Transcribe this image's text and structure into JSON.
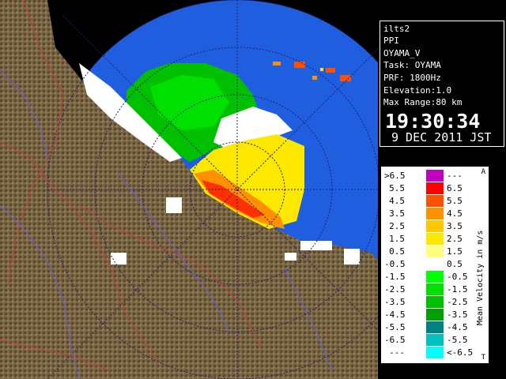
{
  "info": {
    "lines": [
      "ilts2",
      "PPI",
      "OYAMA_V",
      "Task: OYAMA",
      "PRF: 1800Hz",
      "Elevation:1.0",
      "Max Range:80 km"
    ],
    "time": "19:30:34",
    "date": "9 DEC 2011 JST"
  },
  "legend": {
    "unit": "Mean Velocity in m/s",
    "corner_top": "A",
    "corner_bottom": "T",
    "rows": [
      {
        "a": ">6.5",
        "b": "---",
        "color": "#c000c0"
      },
      {
        "a": "5.5",
        "b": "6.5",
        "color": "#ff0000"
      },
      {
        "a": "4.5",
        "b": "5.5",
        "color": "#ff5000"
      },
      {
        "a": "3.5",
        "b": "4.5",
        "color": "#ff9000"
      },
      {
        "a": "2.5",
        "b": "3.5",
        "color": "#ffc800"
      },
      {
        "a": "1.5",
        "b": "2.5",
        "color": "#ffe800"
      },
      {
        "a": "0.5",
        "b": "1.5",
        "color": "#ffff80"
      },
      {
        "a": "-0.5",
        "b": "0.5",
        "color": "#ffffff"
      },
      {
        "a": "-1.5",
        "b": "-0.5",
        "color": "#00ff00"
      },
      {
        "a": "-2.5",
        "b": "-1.5",
        "color": "#00e000"
      },
      {
        "a": "-3.5",
        "b": "-2.5",
        "color": "#00c000"
      },
      {
        "a": "-4.5",
        "b": "-3.5",
        "color": "#00a000"
      },
      {
        "a": "-5.5",
        "b": "-4.5",
        "color": "#008080"
      },
      {
        "a": "-6.5",
        "b": "-5.5",
        "color": "#00c0c0"
      },
      {
        "a": "---",
        "b": "<-6.5",
        "color": "#00ffff"
      }
    ]
  },
  "colors": {
    "background": "#000000",
    "range_area": "#1f5fdf",
    "terrain": "#6b5a3a",
    "terrain_dark": "#3a2f1e"
  }
}
